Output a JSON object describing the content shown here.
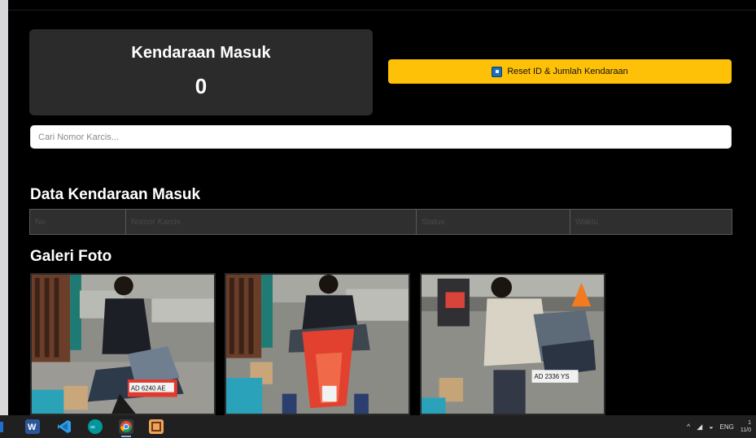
{
  "counter": {
    "title": "Kendaraan Masuk",
    "value": "0"
  },
  "reset_button": {
    "label": "Reset ID & Jumlah Kendaraan",
    "icon": "square-icon",
    "color": "#ffc107"
  },
  "search": {
    "placeholder": "Cari Nomor Karcis..."
  },
  "data_section": {
    "title": "Data Kendaraan Masuk",
    "columns": [
      "No",
      "Nomor Karcis",
      "Status",
      "Waktu"
    ],
    "rows": []
  },
  "gallery": {
    "title": "Galeri Foto",
    "photos": [
      {
        "alt": "photo-1",
        "plate": "AD 6240 AE"
      },
      {
        "alt": "photo-2",
        "plate": ""
      },
      {
        "alt": "photo-3",
        "plate": "AD 2336 YS"
      }
    ]
  },
  "taskbar": {
    "apps": [
      "word-icon",
      "vscode-icon",
      "arduino-icon",
      "chrome-icon",
      "app-icon"
    ],
    "tray_language": "ENG",
    "clock_time": "1",
    "clock_date": "11/0"
  },
  "colors": {
    "background": "#000000",
    "card": "#2b2b2b",
    "accent": "#ffc107"
  }
}
